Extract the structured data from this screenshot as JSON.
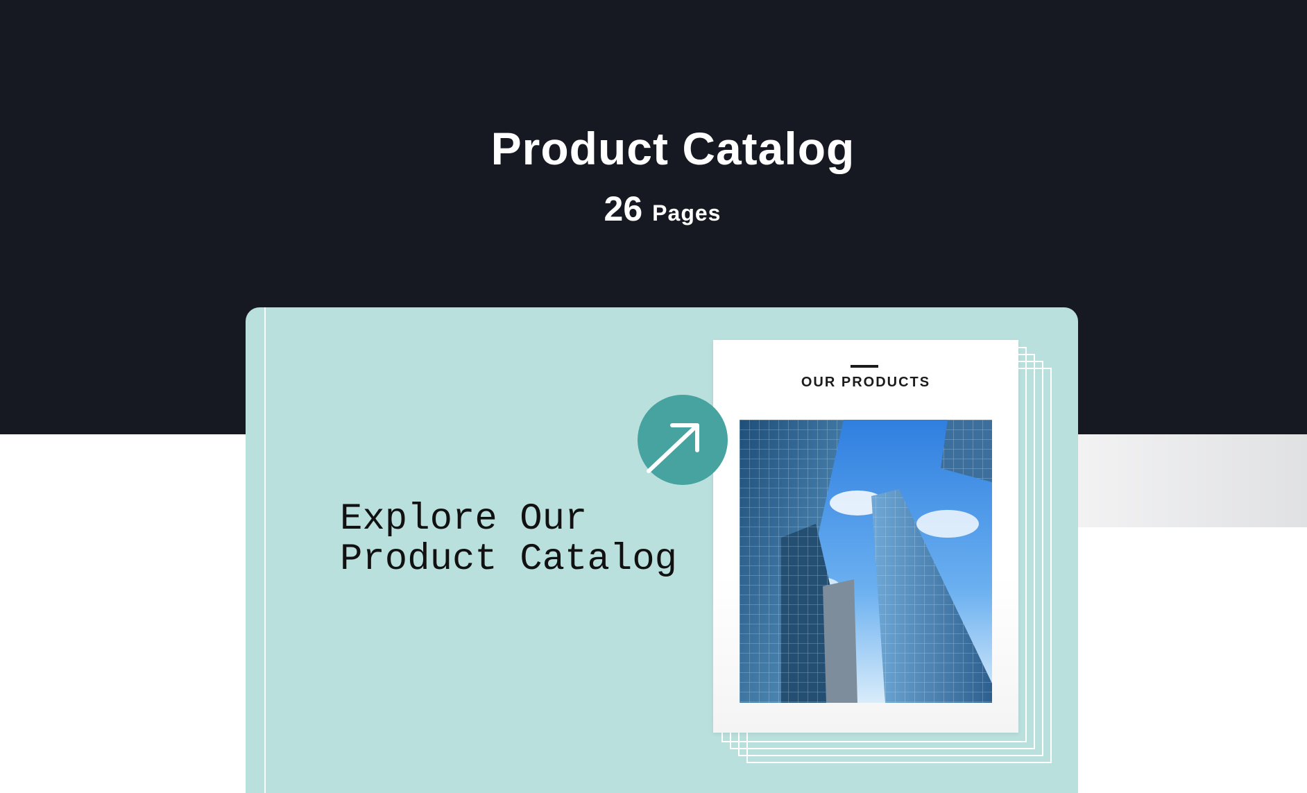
{
  "header": {
    "title": "Product Catalog",
    "page_count": "26",
    "page_count_unit": "Pages"
  },
  "card": {
    "heading_line1": "Explore Our",
    "heading_line2": "Product Catalog",
    "preview_label": "OUR PRODUCTS",
    "image_subject": "glass skyscrapers against blue sky",
    "action_icon": "arrow-up-right-icon"
  },
  "colors": {
    "hero_background": "#161922",
    "card_background": "#bae0de",
    "accent": "#46a3a0",
    "text_light": "#ffffff",
    "text_dark": "#111111"
  }
}
